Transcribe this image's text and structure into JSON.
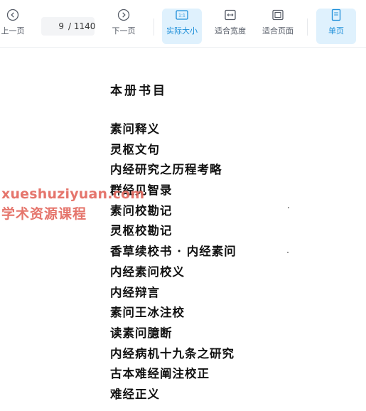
{
  "toolbar": {
    "prev_label": "上一页",
    "next_label": "下一页",
    "current_page": "9",
    "total_pages": "/ 1140",
    "actual_size_label": "实际大小",
    "fit_width_label": "适合宽度",
    "fit_page_label": "适合页面",
    "single_page_label": "单页",
    "actual_size_icon_text": "1:1",
    "accent_color": "#1c8ed9"
  },
  "document": {
    "title": "本册书目",
    "items": [
      "素问释义",
      "灵枢文句",
      "内经研究之历程考略",
      "群经见智录",
      "素问校勘记",
      "灵枢校勘记",
      "香草续校书 · 内经素问",
      "内经素问校义",
      "内经辩言",
      "素问王冰注校",
      "读素问臆断",
      "内经病机十九条之研究",
      "古本难经阐注校正",
      "难经正义"
    ]
  },
  "watermark": {
    "line1": "xueshuziyuan.com",
    "line2": "学术资源课程",
    "color": "#e36a60"
  }
}
